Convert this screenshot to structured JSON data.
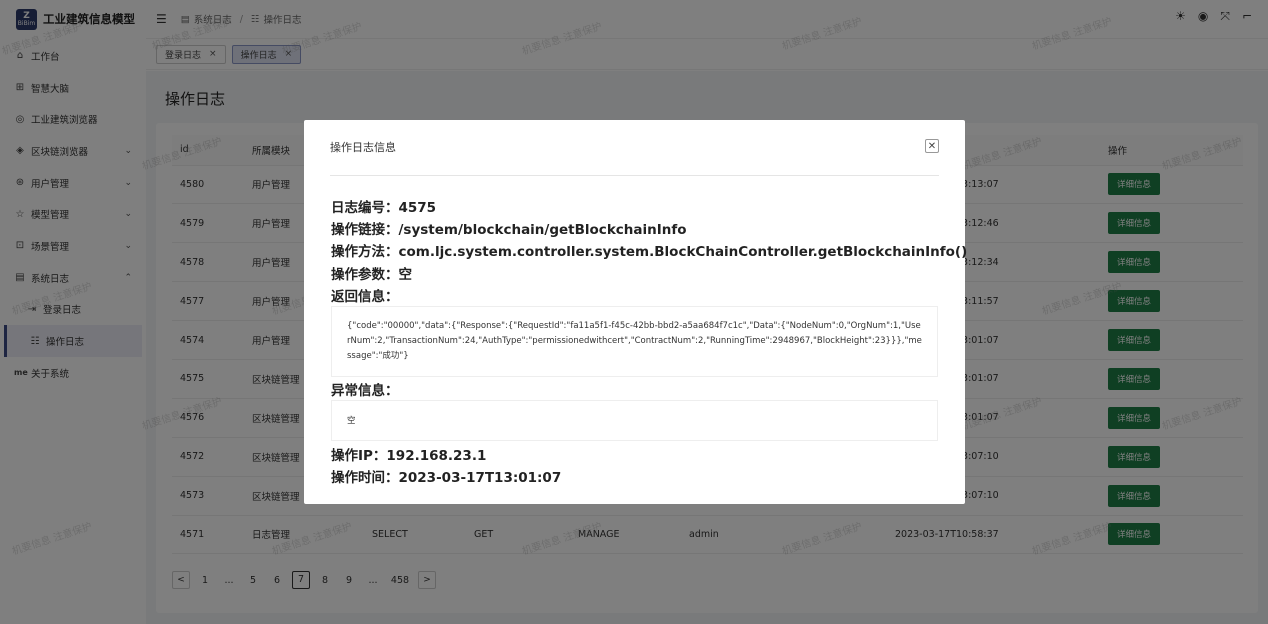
{
  "app": {
    "logo_small": "BiBim",
    "logo_big": "Z",
    "title": "工业建筑信息模型"
  },
  "sidebar": {
    "items": [
      {
        "label": "工作台",
        "icon": "home-icon",
        "glyph": "⌂"
      },
      {
        "label": "智慧大脑",
        "icon": "brain-icon",
        "glyph": "⊞"
      },
      {
        "label": "工业建筑浏览器",
        "icon": "browser-icon",
        "glyph": "◎"
      },
      {
        "label": "区块链浏览器",
        "icon": "blockchain-icon",
        "glyph": "◈"
      },
      {
        "label": "用户管理",
        "icon": "user-icon",
        "glyph": "⊛"
      },
      {
        "label": "模型管理",
        "icon": "model-icon",
        "glyph": "☆"
      },
      {
        "label": "场景管理",
        "icon": "scene-icon",
        "glyph": "⊡"
      },
      {
        "label": "系统日志",
        "icon": "log-icon",
        "glyph": "▤"
      },
      {
        "label": "登录日志",
        "icon": "login-log-icon",
        "glyph": "⇥"
      },
      {
        "label": "操作日志",
        "icon": "operation-log-icon",
        "glyph": "☷"
      },
      {
        "label": "关于系统",
        "icon": "about-icon",
        "glyph": "me"
      }
    ]
  },
  "header": {
    "breadcrumb": [
      "系统日志",
      "操作日志"
    ],
    "breadcrumb_sep": "/"
  },
  "tags": [
    {
      "label": "登录日志"
    },
    {
      "label": "操作日志"
    }
  ],
  "page": {
    "title": "操作日志"
  },
  "table": {
    "headers": [
      "id",
      "所属模块",
      "",
      "",
      "",
      "",
      "",
      "操作"
    ],
    "rows": [
      {
        "id": "4580",
        "module": "用户管理",
        "c3": "",
        "c4": "",
        "c5": "",
        "c6": "",
        "time": "2023-03-17T13:13:07",
        "action": "详细信息"
      },
      {
        "id": "4579",
        "module": "用户管理",
        "c3": "",
        "c4": "",
        "c5": "",
        "c6": "",
        "time": "2023-03-17T13:12:46",
        "action": "详细信息"
      },
      {
        "id": "4578",
        "module": "用户管理",
        "c3": "",
        "c4": "",
        "c5": "",
        "c6": "",
        "time": "2023-03-17T13:12:34",
        "action": "详细信息"
      },
      {
        "id": "4577",
        "module": "用户管理",
        "c3": "",
        "c4": "",
        "c5": "",
        "c6": "",
        "time": "2023-03-17T13:11:57",
        "action": "详细信息"
      },
      {
        "id": "4574",
        "module": "用户管理",
        "c3": "",
        "c4": "",
        "c5": "",
        "c6": "",
        "time": "2023-03-17T13:01:07",
        "action": "详细信息"
      },
      {
        "id": "4575",
        "module": "区块链管理",
        "c3": "",
        "c4": "",
        "c5": "",
        "c6": "",
        "time": "2023-03-17T13:01:07",
        "action": "详细信息"
      },
      {
        "id": "4576",
        "module": "区块链管理",
        "c3": "",
        "c4": "",
        "c5": "",
        "c6": "",
        "time": "2023-03-17T13:01:07",
        "action": "详细信息"
      },
      {
        "id": "4572",
        "module": "区块链管理",
        "c3": "",
        "c4": "",
        "c5": "",
        "c6": "",
        "time": "2023-03-17T13:07:10",
        "action": "详细信息"
      },
      {
        "id": "4573",
        "module": "区块链管理",
        "c3": "",
        "c4": "",
        "c5": "",
        "c6": "",
        "time": "2023-03-17T13:07:10",
        "action": "详细信息"
      },
      {
        "id": "4571",
        "module": "日志管理",
        "c3": "SELECT",
        "c4": "GET",
        "c5": "MANAGE",
        "c6": "admin",
        "time": "2023-03-17T10:58:37",
        "action": "详细信息"
      }
    ]
  },
  "pager": {
    "prev": "<",
    "next": ">",
    "pages": [
      "1",
      "...",
      "5",
      "6",
      "7",
      "8",
      "9",
      "...",
      "458"
    ],
    "current": "7"
  },
  "modal": {
    "title": "操作日志信息",
    "close": "✕",
    "log_id": "日志编号：4575",
    "link": "操作链接：/system/blockchain/getBlockchainInfo",
    "method": "操作方法：com.ljc.system.controller.system.BlockChainController.getBlockchainInfo()",
    "params": "操作参数：空",
    "return_label": "返回信息：",
    "return_text": "{\"code\":\"00000\",\"data\":{\"Response\":{\"RequestId\":\"fa11a5f1-f45c-42bb-bbd2-a5aa684f7c1c\",\"Data\":{\"NodeNum\":0,\"OrgNum\":1,\"UserNum\":2,\"TransactionNum\":24,\"AuthType\":\"permissionedwithcert\",\"ContractNum\":2,\"RunningTime\":2948967,\"BlockHeight\":23}}},\"message\":\"成功\"}",
    "exception_label": "异常信息：",
    "exception_text": "空",
    "ip": "操作IP：192.168.23.1",
    "time": "操作时间：2023-03-17T13:01:07"
  },
  "watermark": "机要信息 注意保护"
}
